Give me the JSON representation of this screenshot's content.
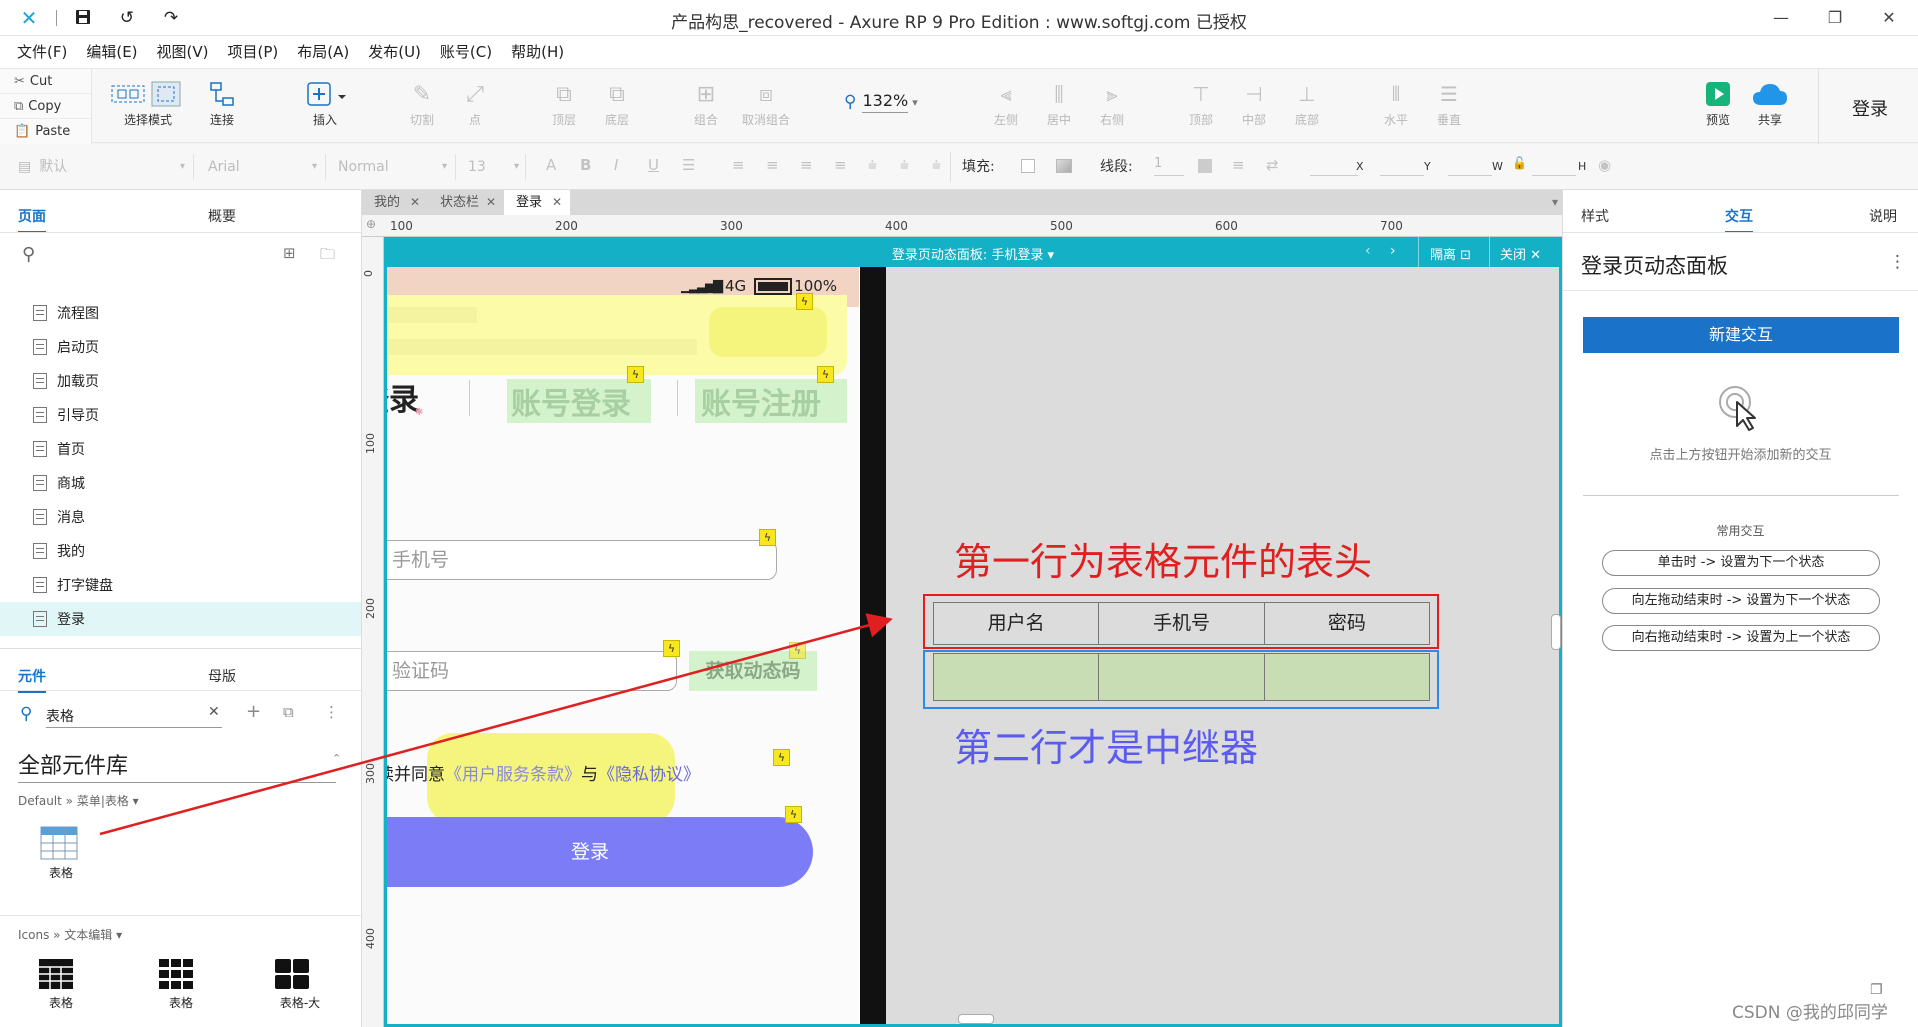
{
  "window": {
    "title": "产品构思_recovered - Axure RP 9 Pro Edition : www.softgj.com 已授权"
  },
  "menu": [
    "文件(F)",
    "编辑(E)",
    "视图(V)",
    "项目(P)",
    "布局(A)",
    "发布(U)",
    "账号(C)",
    "帮助(H)"
  ],
  "clipboard": {
    "cut": "Cut",
    "copy": "Copy",
    "paste": "Paste"
  },
  "toolbar": {
    "select_mode": "选择模式",
    "connect": "连接",
    "insert": "插入",
    "cut_tool": "切割",
    "point": "点",
    "top_layer": "顶层",
    "bottom_layer": "底层",
    "group": "组合",
    "ungroup": "取消组合",
    "zoom": "132%",
    "align_left": "左侧",
    "align_center": "居中",
    "align_right": "右侧",
    "align_top": "顶部",
    "align_middle": "中部",
    "align_bottom": "底部",
    "dist_h": "水平",
    "dist_v": "垂直",
    "preview": "预览",
    "share": "共享",
    "login": "登录"
  },
  "formatbar": {
    "style": "默认",
    "font": "Arial",
    "weight": "Normal",
    "size": "13",
    "fill_label": "填充:",
    "line_label": "线段:",
    "line_value": "1",
    "x_label": "X",
    "y_label": "Y",
    "w_label": "W",
    "h_label": "H"
  },
  "leftpanel": {
    "tab_pages": "页面",
    "tab_outline": "概要",
    "pages": [
      "流程图",
      "启动页",
      "加载页",
      "引导页",
      "首页",
      "商城",
      "消息",
      "我的",
      "打字键盘",
      "登录"
    ],
    "selected_page": "登录",
    "tab_widgets": "元件",
    "tab_masters": "母版",
    "search_value": "表格",
    "library_title": "全部元件库",
    "library_path": "Default » 菜单|表格 ▾",
    "widget_table": "表格",
    "icons_path": "Icons » 文本编辑 ▾",
    "icon_items": [
      "表格",
      "表格",
      "表格-大"
    ]
  },
  "doc_tabs": [
    {
      "label": "我的"
    },
    {
      "label": "状态栏"
    },
    {
      "label": "登录"
    }
  ],
  "ruler_h": [
    "100",
    "200",
    "300",
    "400",
    "500",
    "600",
    "700"
  ],
  "ruler_v": [
    "0",
    "100",
    "200",
    "300",
    "400"
  ],
  "dynamic_panel": {
    "title": "登录页动态面板: 手机登录 ▾",
    "isolate": "隔离",
    "close": "关闭"
  },
  "phone": {
    "status": "4G",
    "battery": "100%",
    "tab_partial": "登录",
    "tab_account_login": "账号登录",
    "tab_account_register": "账号注册",
    "phone_placeholder": "手机号",
    "code_placeholder": "验证码",
    "get_code": "获取动态码",
    "agree_prefix": "读并同意",
    "agree_terms": "《用户服务条款》",
    "agree_and": "与",
    "agree_privacy": "《隐私协议》",
    "login_button": "登录"
  },
  "annotation": {
    "header_note": "第一行为表格元件的表头",
    "repeater_note": "第二行才是中继器",
    "table_headers": [
      "用户名",
      "手机号",
      "密码"
    ]
  },
  "rightpanel": {
    "tab_style": "样式",
    "tab_interact": "交互",
    "tab_notes": "说明",
    "panel_title": "登录页动态面板",
    "new_interaction": "新建交互",
    "hint": "点击上方按钮开始添加新的交互",
    "common_title": "常用交互",
    "common": [
      "单击时 -> 设置为下一个状态",
      "向左拖动结束时 -> 设置为下一个状态",
      "向右拖动结束时 -> 设置为上一个状态"
    ]
  },
  "watermark": "CSDN @我的邱同学",
  "colors": {
    "accent": "#1a73c8",
    "panel_teal": "#14b1c6",
    "login_button": "#7b7cf6",
    "annotation_red": "#e02020",
    "annotation_blue": "#5b5bf0",
    "repeater_row": "#c8ddb4"
  }
}
